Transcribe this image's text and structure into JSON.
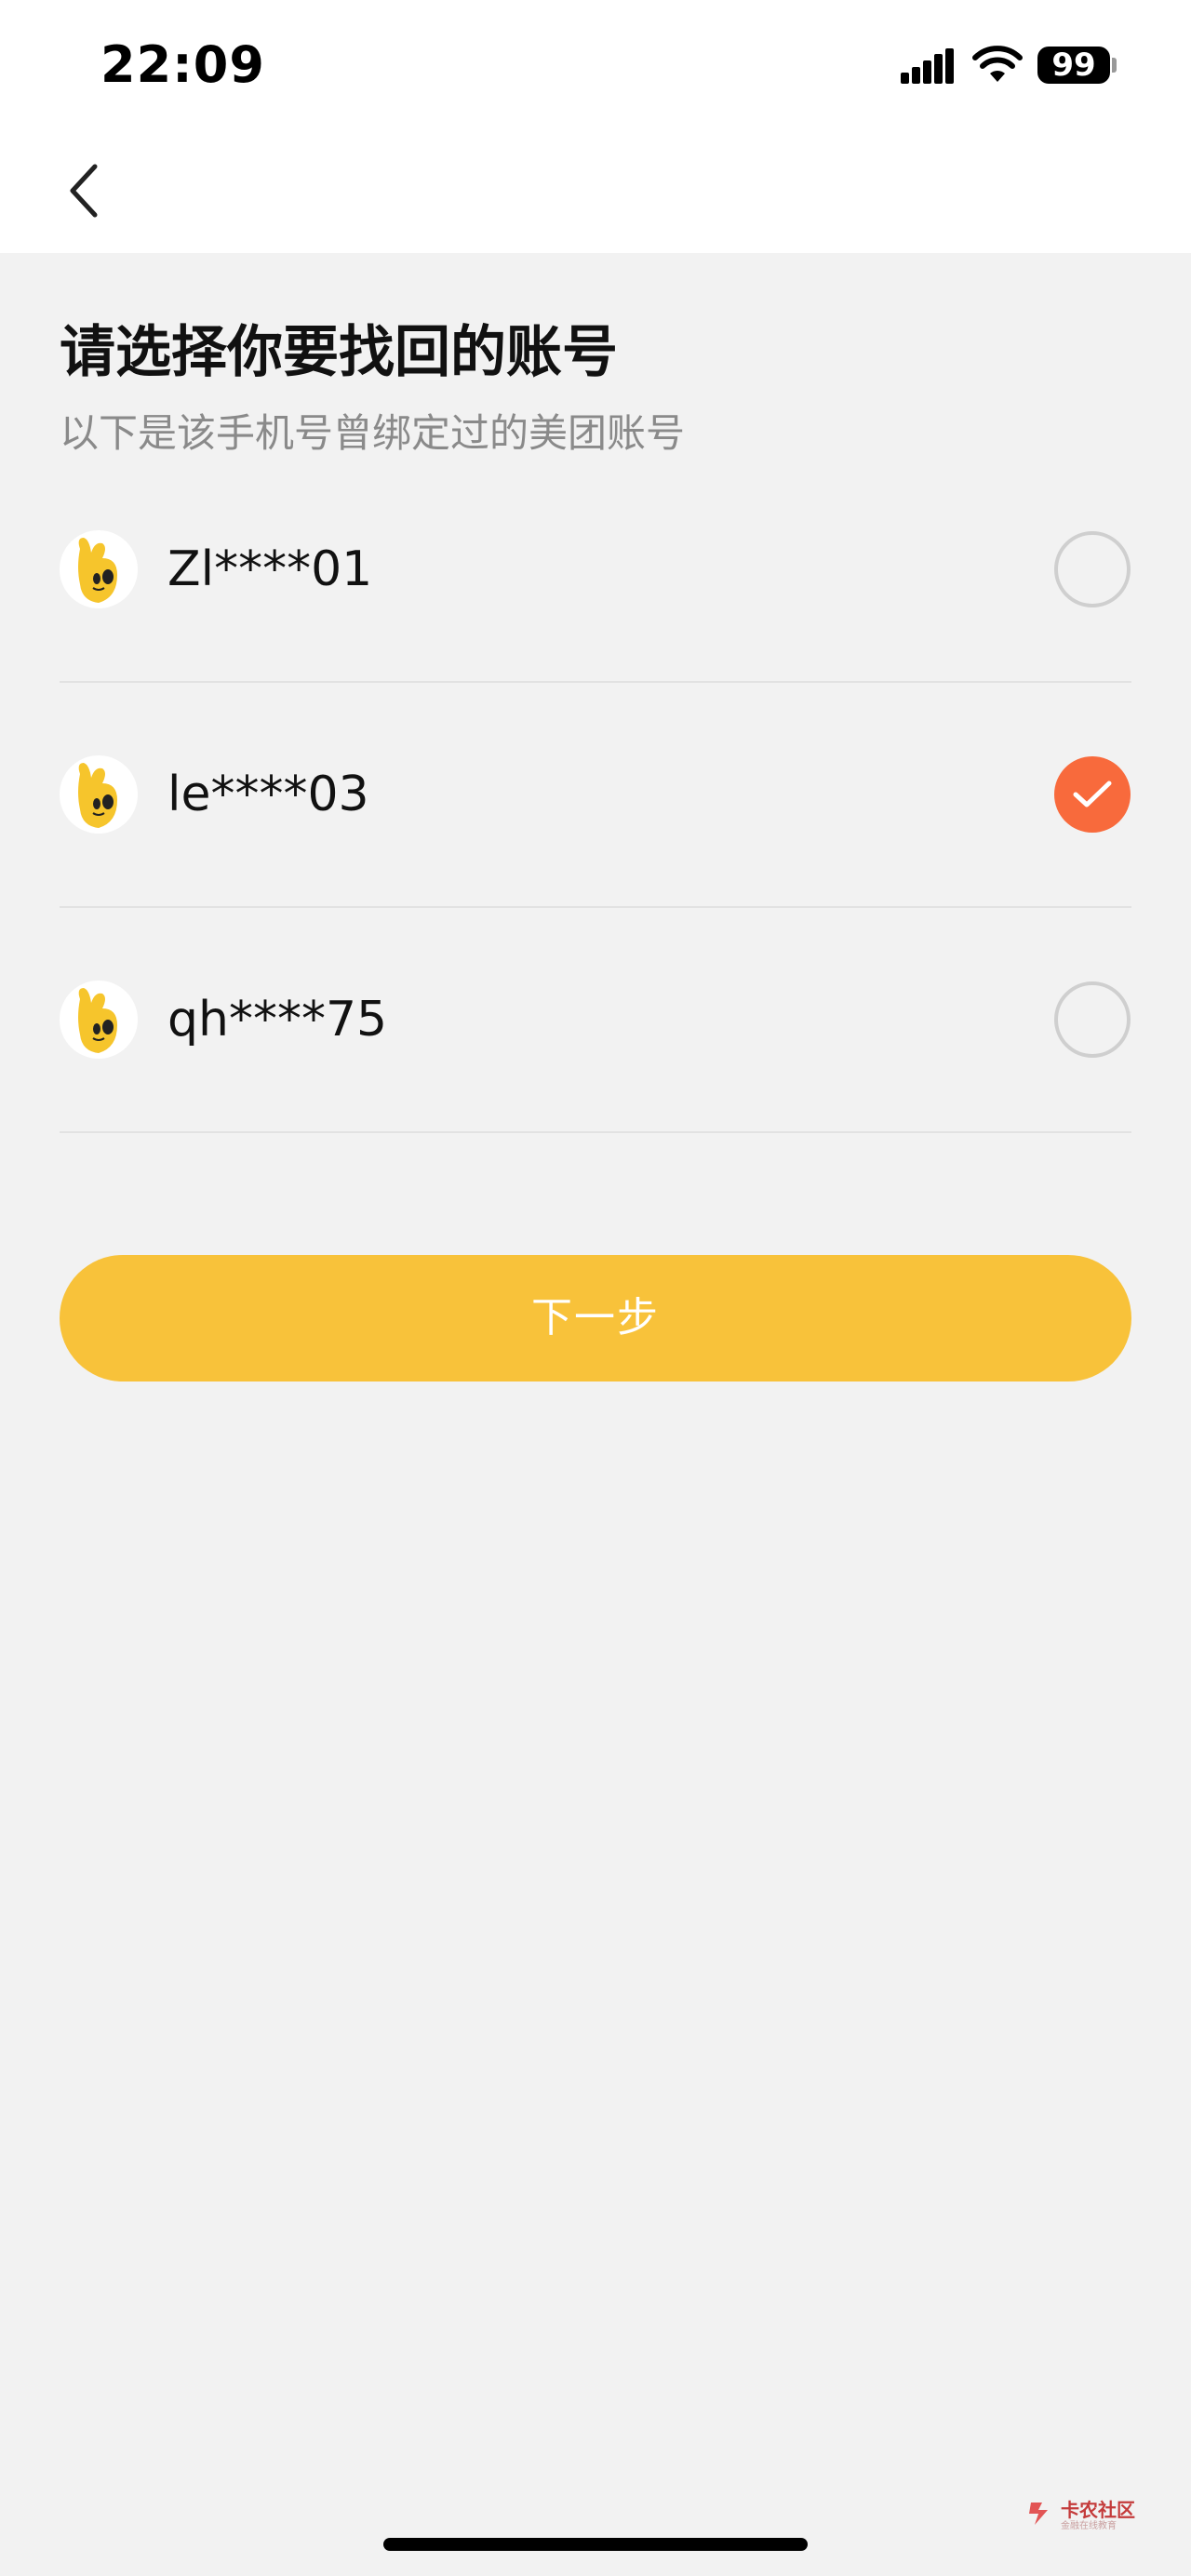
{
  "status_bar": {
    "time": "22:09",
    "battery": "99",
    "icons": [
      "signal-icon",
      "wifi-icon",
      "battery-icon"
    ]
  },
  "nav": {
    "back_icon": "chevron-left-icon"
  },
  "page": {
    "title": "请选择你要找回的账号",
    "subtitle": "以下是该手机号曾绑定过的美团账号"
  },
  "accounts": [
    {
      "name": "Zl****01",
      "selected": false,
      "avatar_icon": "mascot-avatar-icon"
    },
    {
      "name": "le****03",
      "selected": true,
      "avatar_icon": "mascot-avatar-icon"
    },
    {
      "name": "qh****75",
      "selected": false,
      "avatar_icon": "mascot-avatar-icon"
    }
  ],
  "next_button": {
    "label": "下一步"
  },
  "watermark": {
    "text": "卡农社区",
    "subtext": "金融在线教育"
  },
  "colors": {
    "accent_yellow": "#f8c23a",
    "check_orange": "#f86a3c",
    "background": "#f2f2f2",
    "subtitle_gray": "#8a8a8a"
  }
}
